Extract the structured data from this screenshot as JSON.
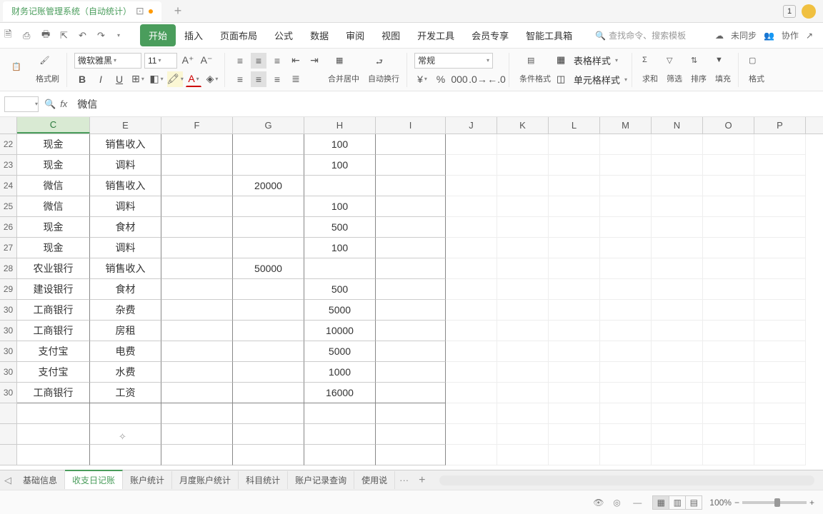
{
  "window": {
    "title": "财务记账管理系统（自动统计）",
    "badge": "1"
  },
  "menu": {
    "items": [
      "开始",
      "插入",
      "页面布局",
      "公式",
      "数据",
      "审阅",
      "视图",
      "开发工具",
      "会员专享",
      "智能工具箱"
    ],
    "active": 0,
    "search_placeholder": "查找命令、搜索模板",
    "right": {
      "sync": "未同步",
      "collab": "协作"
    }
  },
  "ribbon": {
    "format_painter": "格式刷",
    "font_name": "微软雅黑",
    "font_size": "11",
    "number_format": "常规",
    "merge": "合并居中",
    "wrap": "自动换行",
    "cond_fmt": "条件格式",
    "table_style": "表格样式",
    "cell_style": "单元格样式",
    "sum": "求和",
    "filter": "筛选",
    "sort": "排序",
    "fill": "填充",
    "format": "格式"
  },
  "formula_bar": {
    "value": "微信"
  },
  "columns": [
    "C",
    "E",
    "F",
    "G",
    "H",
    "I",
    "J",
    "K",
    "L",
    "M",
    "N",
    "O",
    "P"
  ],
  "active_col": "C",
  "rows": [
    {
      "n": "22",
      "C": "现金",
      "E": "销售收入",
      "G": "",
      "H": "100"
    },
    {
      "n": "23",
      "C": "现金",
      "E": "调料",
      "G": "",
      "H": "100"
    },
    {
      "n": "24",
      "C": "微信",
      "E": "销售收入",
      "G": "20000",
      "H": ""
    },
    {
      "n": "25",
      "C": "微信",
      "E": "调料",
      "G": "",
      "H": "100"
    },
    {
      "n": "26",
      "C": "现金",
      "E": "食材",
      "G": "",
      "H": "500"
    },
    {
      "n": "27",
      "C": "现金",
      "E": "调料",
      "G": "",
      "H": "100"
    },
    {
      "n": "28",
      "C": "农业银行",
      "E": "销售收入",
      "G": "50000",
      "H": ""
    },
    {
      "n": "29",
      "C": "建设银行",
      "E": "食材",
      "G": "",
      "H": "500"
    },
    {
      "n": "30",
      "C": "工商银行",
      "E": "杂费",
      "G": "",
      "H": "5000"
    },
    {
      "n": "30",
      "C": "工商银行",
      "E": "房租",
      "G": "",
      "H": "10000"
    },
    {
      "n": "30",
      "C": "支付宝",
      "E": "电费",
      "G": "",
      "H": "5000"
    },
    {
      "n": "30",
      "C": "支付宝",
      "E": "水费",
      "G": "",
      "H": "1000"
    },
    {
      "n": "30",
      "C": "工商银行",
      "E": "工资",
      "G": "",
      "H": "16000"
    },
    {
      "n": "",
      "C": "",
      "E": "",
      "G": "",
      "H": ""
    },
    {
      "n": "",
      "C": "",
      "E": "",
      "G": "",
      "H": ""
    },
    {
      "n": "",
      "C": "",
      "E": "",
      "G": "",
      "H": ""
    }
  ],
  "sheets": {
    "tabs": [
      "基础信息",
      "收支日记账",
      "账户统计",
      "月度账户统计",
      "科目统计",
      "账户记录查询",
      "使用说"
    ],
    "active": 1
  },
  "status": {
    "zoom": "100%"
  }
}
